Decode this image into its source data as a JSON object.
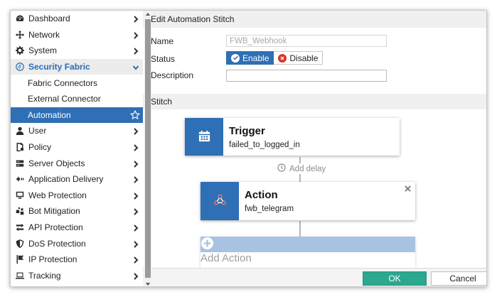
{
  "sidebar": {
    "items": [
      {
        "label": "Dashboard",
        "icon": "dashboard-icon"
      },
      {
        "label": "Network",
        "icon": "network-icon"
      },
      {
        "label": "System",
        "icon": "gear-icon"
      },
      {
        "label": "Security Fabric",
        "icon": "security-fabric-icon",
        "expanded": true,
        "children": [
          {
            "label": "Fabric Connectors"
          },
          {
            "label": "External Connector"
          },
          {
            "label": "Automation",
            "active": true
          }
        ]
      },
      {
        "label": "User",
        "icon": "user-icon"
      },
      {
        "label": "Policy",
        "icon": "policy-icon"
      },
      {
        "label": "Server Objects",
        "icon": "server-icon"
      },
      {
        "label": "Application Delivery",
        "icon": "application-delivery-icon"
      },
      {
        "label": "Web Protection",
        "icon": "web-protection-icon"
      },
      {
        "label": "Bot Mitigation",
        "icon": "bot-icon"
      },
      {
        "label": "API Protection",
        "icon": "api-icon"
      },
      {
        "label": "DoS Protection",
        "icon": "shield-icon"
      },
      {
        "label": "IP Protection",
        "icon": "flag-icon"
      },
      {
        "label": "Tracking",
        "icon": "laptop-icon"
      }
    ]
  },
  "panel": {
    "title": "Edit Automation Stitch"
  },
  "form": {
    "name_label": "Name",
    "name_value": "FWB_Webhook",
    "status_label": "Status",
    "enable_label": "Enable",
    "disable_label": "Disable",
    "status_selected": "Enable",
    "description_label": "Description",
    "description_value": ""
  },
  "stitch": {
    "section_label": "Stitch",
    "trigger": {
      "title": "Trigger",
      "value": "failed_to_logged_in"
    },
    "add_delay_label": "Add delay",
    "action": {
      "title": "Action",
      "value": "fwb_telegram"
    },
    "add_action_label": "Add Action"
  },
  "footer": {
    "ok_label": "OK",
    "cancel_label": "Cancel"
  },
  "colors": {
    "accent": "#2e6fb5",
    "ok": "#2ba88e",
    "disable": "#d9342b",
    "tile_light": "#a8c3e2"
  }
}
